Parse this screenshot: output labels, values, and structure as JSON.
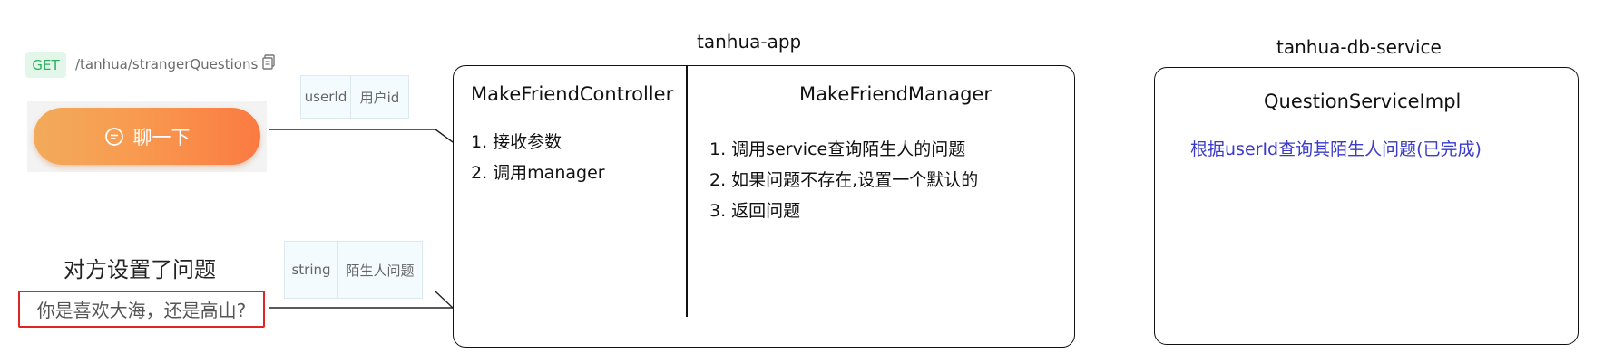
{
  "api": {
    "method": "GET",
    "path": "/tanhua/strangerQuestions",
    "copy_icon": "copy-icon"
  },
  "chat_button": {
    "label": "聊一下",
    "icon": "chat-bubble-icon"
  },
  "request_params": {
    "name": "userId",
    "desc": "用户id"
  },
  "response_params": {
    "type": "string",
    "desc": "陌生人问题"
  },
  "question_display": {
    "title": "对方设置了问题",
    "question": "你是喜欢大海，还是高山?"
  },
  "app_service": {
    "name": "tanhua-app",
    "controller": {
      "name": "MakeFriendController",
      "steps": [
        "1. 接收参数",
        "2. 调用manager"
      ]
    },
    "manager": {
      "name": "MakeFriendManager",
      "steps": [
        "1. 调用service查询陌生人的问题",
        "2. 如果问题不存在,设置一个默认的",
        "3. 返回问题"
      ]
    }
  },
  "db_service": {
    "name": "tanhua-db-service",
    "impl": {
      "name": "QuestionServiceImpl",
      "desc": "根据userId查询其陌生人问题(已完成)"
    }
  },
  "colors": {
    "button_gradient_start": "#f2ab5b",
    "button_gradient_end": "#fb7a42",
    "method_bg": "#e3f6ea",
    "method_text": "#2fae5f",
    "question_border": "#e02424",
    "db_desc_text": "#3a3acb"
  }
}
